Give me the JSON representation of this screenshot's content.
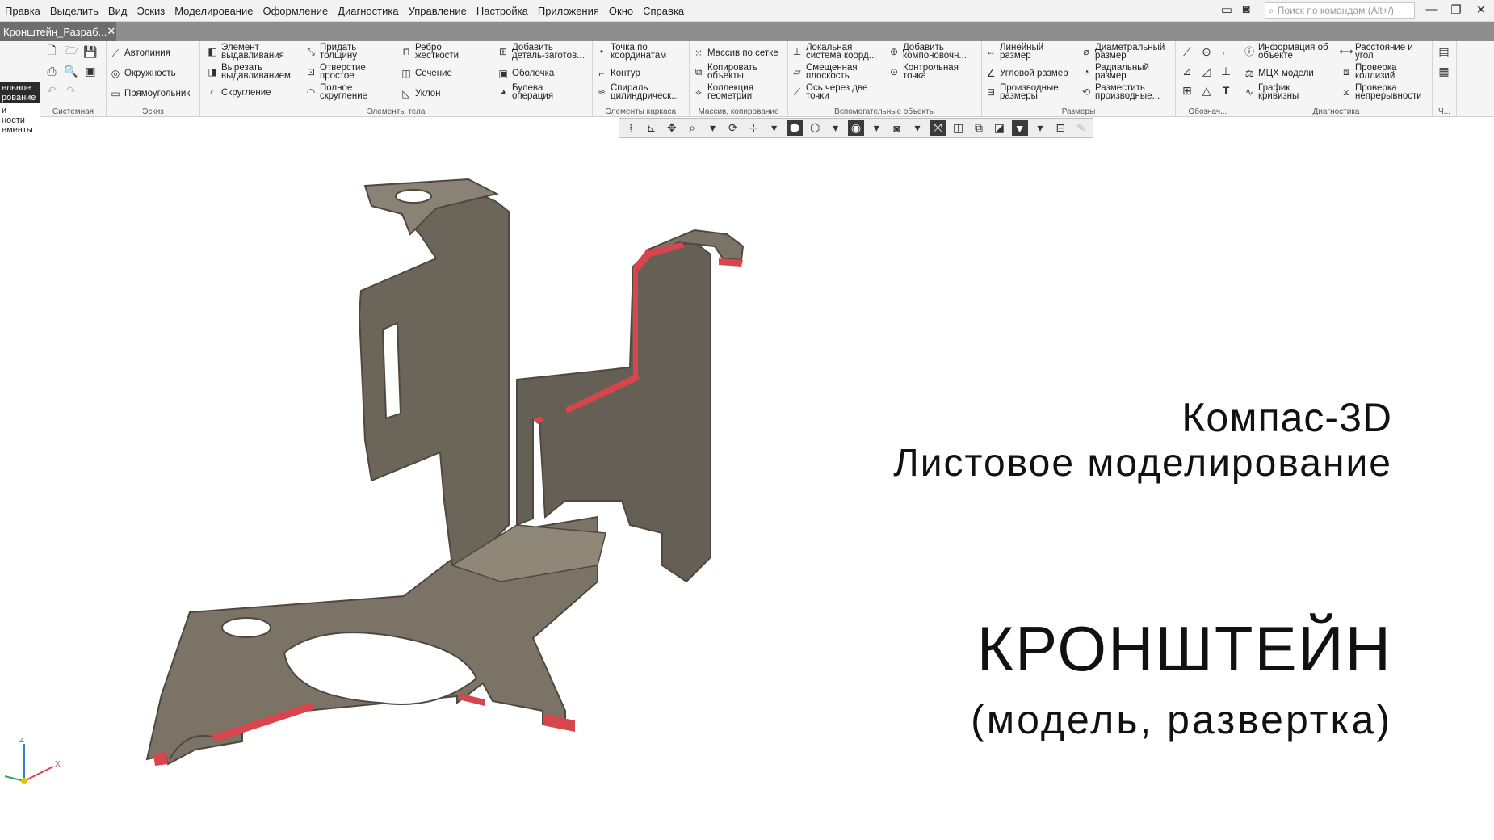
{
  "menubar": {
    "items": [
      "Правка",
      "Выделить",
      "Вид",
      "Эскиз",
      "Моделирование",
      "Оформление",
      "Диагностика",
      "Управление",
      "Настройка",
      "Приложения",
      "Окно",
      "Справка"
    ],
    "search_placeholder": "Поиск по командам (Alt+/)"
  },
  "doc_tab": {
    "title": "Кронштейн_Разраб...",
    "close": "✕"
  },
  "left_panel": {
    "highlight": [
      "ельное",
      "рование"
    ],
    "lines": [
      "и",
      "ности",
      "ементы"
    ]
  },
  "ribbon": {
    "groups": {
      "system": "Системная",
      "sketch": "Эскиз",
      "body": "Элементы тела",
      "frame": "Элементы каркаса",
      "array": "Массив, копирование",
      "aux": "Вспомогательные объекты",
      "dims": "Размеры",
      "marks": "Обознач...",
      "diag": "Диагностика",
      "last": "Ч..."
    },
    "sketch": [
      "Автолиния",
      "Окружность",
      "Прямоугольник"
    ],
    "body": [
      [
        "Элемент",
        "выдавливания"
      ],
      [
        "Вырезать",
        "выдавливанием"
      ],
      [
        "Скругление"
      ],
      [
        "Придать",
        "толщину"
      ],
      [
        "Отверстие",
        "простое"
      ],
      [
        "Полное",
        "скругление"
      ],
      [
        "Ребро",
        "жесткости"
      ],
      [
        "Сечение"
      ],
      [
        "Уклон"
      ],
      [
        "Добавить",
        "деталь-заготов..."
      ],
      [
        "Оболочка"
      ],
      [
        "Булева",
        "операция"
      ]
    ],
    "frame": [
      [
        "Точка по",
        "координатам"
      ],
      [
        "Контур"
      ],
      [
        "Спираль",
        "цилиндрическ..."
      ]
    ],
    "array": [
      [
        "Массив по сетке"
      ],
      [
        "Копировать",
        "объекты"
      ],
      [
        "Коллекция",
        "геометрии"
      ]
    ],
    "aux": [
      [
        "Локальная",
        "система коорд..."
      ],
      [
        "Смещенная",
        "плоскость"
      ],
      [
        "Ось через две",
        "точки"
      ],
      [
        "Добавить",
        "компоновочн..."
      ],
      [
        "Контрольная",
        "точка"
      ]
    ],
    "dims": [
      [
        "Линейный",
        "размер"
      ],
      [
        "Угловой размер"
      ],
      [
        "Производные",
        "размеры"
      ],
      [
        "Диаметральный",
        "размер"
      ],
      [
        "Радиальный",
        "размер"
      ],
      [
        "Разместить",
        "производные..."
      ]
    ],
    "diag": [
      [
        "Информация об",
        "объекте"
      ],
      [
        "МЦХ модели"
      ],
      [
        "График",
        "кривизны"
      ],
      [
        "Расстояние и",
        "угол"
      ],
      [
        "Проверка",
        "коллизий"
      ],
      [
        "Проверка",
        "непрерывности"
      ]
    ]
  },
  "caption": {
    "line1": "Компас-3D",
    "line2": "Листовое моделирование",
    "title": "КРОНШТЕЙН",
    "subtitle": "(модель, развертка)"
  },
  "triad": {
    "z": "Z",
    "x": "X"
  },
  "colors": {
    "sheet_metal": "#7b7366",
    "edge_dark": "#4e483f",
    "cut_edge": "#d9454c"
  }
}
